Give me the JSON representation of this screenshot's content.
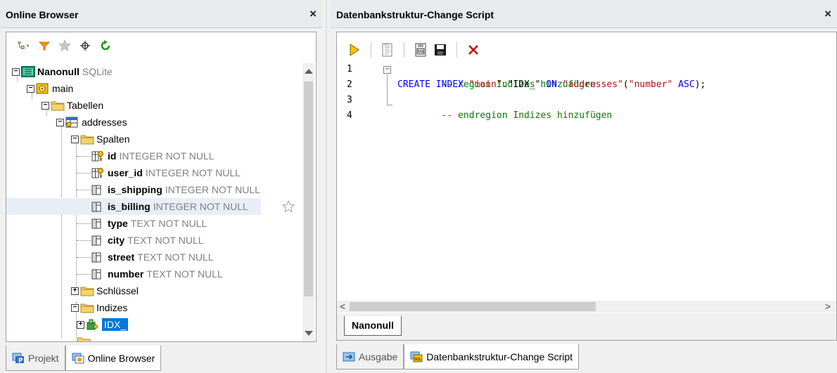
{
  "left_panel": {
    "title": "Online Browser",
    "close_label": "×",
    "tabs": [
      {
        "label": "Projekt",
        "active": false
      },
      {
        "label": "Online Browser",
        "active": true
      }
    ]
  },
  "right_panel": {
    "title": "Datenbankstruktur-Change Script",
    "close_label": "×",
    "doc_tab": "Nanonull",
    "tabs": [
      {
        "label": "Ausgabe",
        "active": false
      },
      {
        "label": "Datenbankstruktur-Change Script",
        "active": true
      }
    ],
    "scroll_left": "<",
    "scroll_right": ">"
  },
  "tree": {
    "root": {
      "name": "Nanonull",
      "suffix": "SQLite"
    },
    "schema": "main",
    "tables_folder": "Tabellen",
    "table": "addresses",
    "columns_folder": "Spalten",
    "columns": [
      {
        "name": "id",
        "type": "INTEGER NOT NULL",
        "key": true
      },
      {
        "name": "user_id",
        "type": "INTEGER NOT NULL",
        "key": true
      },
      {
        "name": "is_shipping",
        "type": "INTEGER NOT NULL",
        "key": false
      },
      {
        "name": "is_billing",
        "type": "INTEGER NOT NULL",
        "key": false
      },
      {
        "name": "type",
        "type": "TEXT NOT NULL",
        "key": false
      },
      {
        "name": "city",
        "type": "TEXT NOT NULL",
        "key": false
      },
      {
        "name": "street",
        "type": "TEXT NOT NULL",
        "key": false
      },
      {
        "name": "number",
        "type": "TEXT NOT NULL",
        "key": false
      }
    ],
    "keys_folder": "Schlüssel",
    "indexes_folder": "Indizes",
    "index": "IDX_"
  },
  "code": {
    "line_numbers": [
      "1",
      "2",
      "3",
      "4"
    ],
    "line1": "-- region Indizes hinzufügen",
    "line2": {
      "kw1": "CREATE INDEX",
      "s1": "\"main\"",
      "dot": ".",
      "s2": "\"IDX_\"",
      "kw2": "ON",
      "s3": "\"addresses\"",
      "p1": "(",
      "s4": "\"number\"",
      "kw3": "ASC",
      "p2": ");"
    },
    "line3": "-- endregion Indizes hinzufügen"
  },
  "colors": {
    "selection": "#0078d7",
    "comment": "#008000",
    "keyword": "#0000ff",
    "string": "#a31515"
  }
}
